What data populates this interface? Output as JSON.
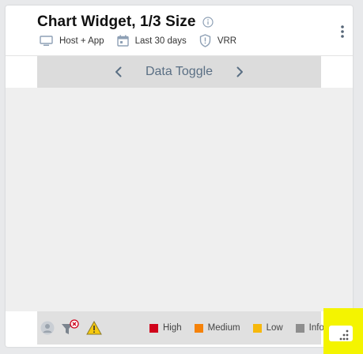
{
  "widget": {
    "title": "Chart Widget, 1/3 Size",
    "meta": {
      "scope": "Host + App",
      "range": "Last 30 days",
      "badge": "VRR"
    }
  },
  "toggle": {
    "label": "Data Toggle"
  },
  "legend": {
    "items": [
      {
        "label": "High",
        "color": "#d0021b"
      },
      {
        "label": "Medium",
        "color": "#f5820a"
      },
      {
        "label": "Low",
        "color": "#f6b80c"
      },
      {
        "label": "Info",
        "color": "#8e8e8e"
      }
    ]
  },
  "colors": {
    "resize_highlight": "#f4f400",
    "accent": "#5a6f84"
  },
  "icons": [
    "info-icon",
    "kebab-menu-icon",
    "monitor-icon",
    "calendar-icon",
    "shield-icon",
    "chevron-left-icon",
    "chevron-right-icon",
    "user-icon",
    "filter-error-icon",
    "warning-icon",
    "resize-grip-icon"
  ]
}
